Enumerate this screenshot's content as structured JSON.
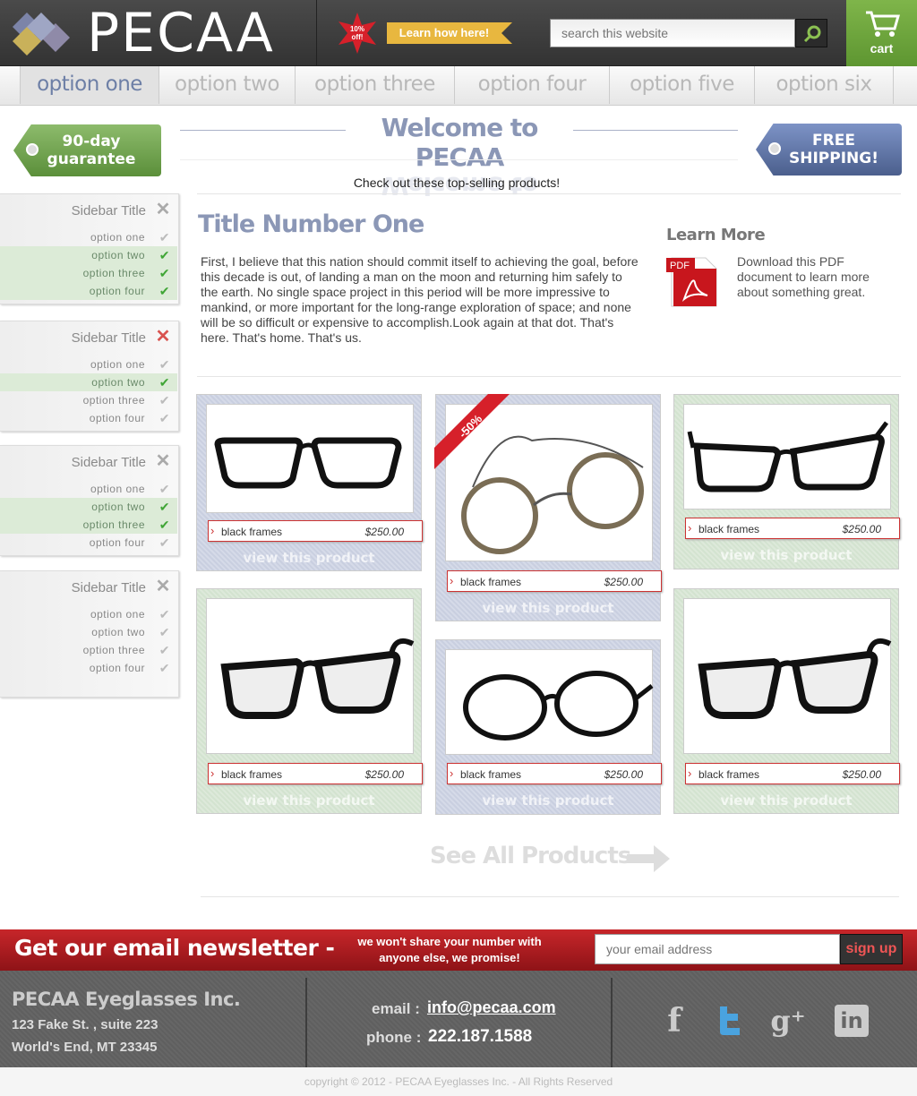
{
  "header": {
    "logo_text": "PECAA",
    "promo_badge": "10% off!",
    "promo_link": "Learn how here!",
    "search_placeholder": "search this website",
    "cart_label": "cart"
  },
  "nav": {
    "items": [
      "option one",
      "option two",
      "option three",
      "option four",
      "option five",
      "option six"
    ],
    "active": "option one"
  },
  "tags": {
    "left": "90-day guarantee",
    "right": "FREE SHIPPING!"
  },
  "welcome": {
    "title": "Welcome to PECAA",
    "subtitle": "Check out these top-selling products!"
  },
  "sidebar": {
    "blocks": [
      {
        "title": "Sidebar Title",
        "close_state": "neutral",
        "options": [
          "option one",
          "option two",
          "option three",
          "option four"
        ],
        "checked": [
          false,
          true,
          true,
          true
        ]
      },
      {
        "title": "Sidebar Title",
        "close_state": "active",
        "options": [
          "option one",
          "option two",
          "option three",
          "option four"
        ],
        "checked": [
          false,
          true,
          false,
          false
        ]
      },
      {
        "title": "Sidebar Title",
        "close_state": "neutral",
        "options": [
          "option one",
          "option two",
          "option three",
          "option four"
        ],
        "checked": [
          false,
          true,
          true,
          false
        ]
      },
      {
        "title": "Sidebar Title",
        "close_state": "neutral",
        "options": [
          "option one",
          "option two",
          "option three",
          "option four"
        ],
        "checked": [
          false,
          false,
          false,
          false
        ]
      }
    ]
  },
  "article": {
    "title": "Title Number One",
    "body": "First, I believe that this nation should commit itself to achieving the goal, before this decade is out, of landing a man on the moon and returning him safely to the earth. No single space project in this period will be more impressive to mankind, or more important for the long-range exploration of space; and none will be so difficult or expensive to accomplish.Look again at that dot. That's here. That's home. That's us."
  },
  "learn_more": {
    "title": "Learn More",
    "pdf_label": "PDF",
    "body": "Download this PDF document to learn more about something great."
  },
  "products": [
    {
      "name": "black frames",
      "price": "$250.00",
      "link": "view this product",
      "color": "blue"
    },
    {
      "name": "black frames",
      "price": "$250.00",
      "link": "view this product",
      "color": "blue",
      "sale": "-50%"
    },
    {
      "name": "black frames",
      "price": "$250.00",
      "link": "view this product",
      "color": "green"
    },
    {
      "name": "black frames",
      "price": "$250.00",
      "link": "view this product",
      "color": "green"
    },
    {
      "name": "black frames",
      "price": "$250.00",
      "link": "view this product",
      "color": "blue"
    },
    {
      "name": "black frames",
      "price": "$250.00",
      "link": "view this product",
      "color": "green"
    }
  ],
  "see_all": "See All Products",
  "newsletter": {
    "title": "Get our email newsletter -",
    "note": "we won't share your number with anyone else, we promise!",
    "placeholder": "your email address",
    "button": "sign up"
  },
  "footer": {
    "company": "PECAA Eyeglasses Inc.",
    "address1": "123 Fake St. , suite 223",
    "address2": "World's End, MT 23345",
    "email_label": "email :",
    "email": "info@pecaa.com",
    "phone_label": "phone :",
    "phone": "222.187.1588",
    "social": [
      "facebook-icon",
      "twitter-icon",
      "google-plus-icon",
      "linkedin-icon"
    ],
    "copyright": "copyright © 2012 - PECAA Eyeglasses Inc. - All Rights Reserved"
  },
  "colors": {
    "accent_blue": "#8b97b6",
    "green": "#6fa543",
    "red": "#c7262a",
    "footer_gray": "#626262"
  }
}
